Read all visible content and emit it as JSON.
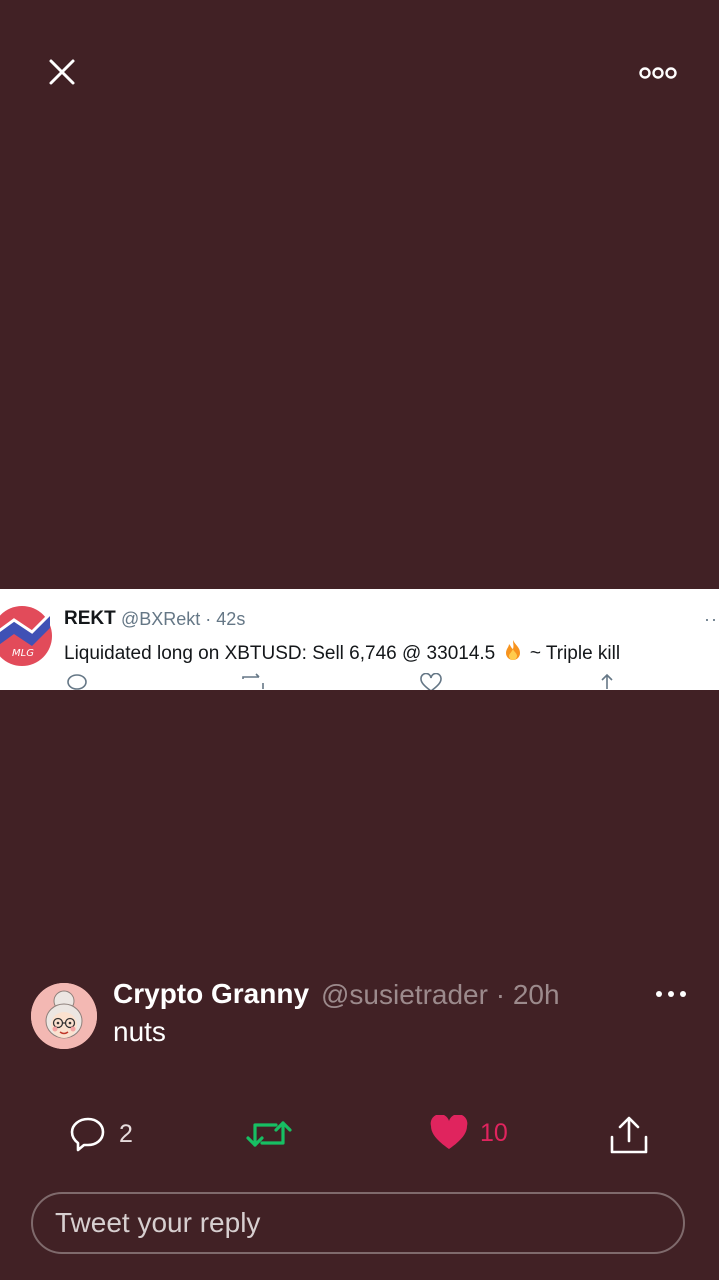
{
  "header": {
    "close_icon": "close-icon",
    "more_icon": "more-horizontal-icon"
  },
  "media": {
    "embedded_tweet": {
      "name": "REKT",
      "handle": "@BXRekt · 42s",
      "text_before": "Liquidated long on XBTUSD: Sell 6,746 @ 33014.5",
      "text_after": "~ Triple kill",
      "logo_text": "MLG",
      "icons": [
        "reply-icon",
        "retweet-icon",
        "like-icon",
        "share-icon"
      ]
    }
  },
  "tweet": {
    "name": "Crypto Granny",
    "handle": "@susietrader · 20h",
    "text": "nuts"
  },
  "actions": {
    "reply_count": "2",
    "retweet_count": "",
    "like_count": "10"
  },
  "reply": {
    "placeholder": "Tweet your reply"
  },
  "colors": {
    "background": "#412125",
    "retweet": "#17bf63",
    "like": "#e0245e"
  }
}
